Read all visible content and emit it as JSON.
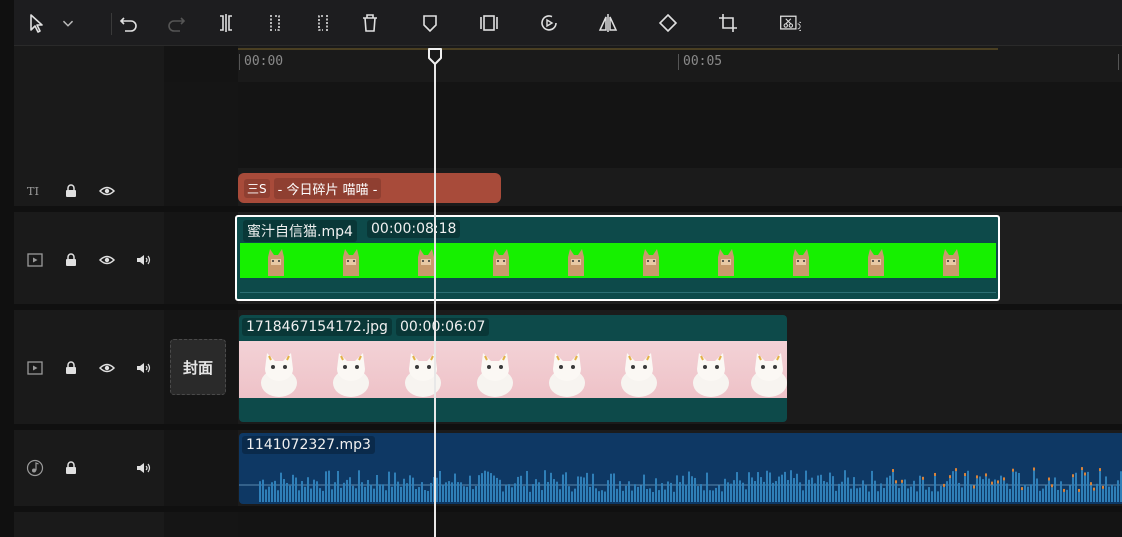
{
  "toolbar": {
    "icons": [
      "select-arrow-icon",
      "dropdown-chevron-icon",
      "undo-icon",
      "redo-icon",
      "split-icon",
      "trim-left-icon",
      "trim-right-icon",
      "delete-icon",
      "marker-icon",
      "freeze-frame-icon",
      "reverse-play-icon",
      "mirror-icon",
      "rotate-icon",
      "crop-icon",
      "cutout-icon"
    ]
  },
  "ruler": {
    "label_0": "00:00",
    "label_5": "00:05"
  },
  "tracks": {
    "text": {
      "clip_glyph": "三S",
      "clip_name": "- 今日碎片 喵喵 -"
    },
    "main_video": {
      "file_name": "蜜汁自信猫.mp4",
      "duration": "00:00:08:18"
    },
    "overlay_image": {
      "file_name": "1718467154172.jpg",
      "duration": "00:00:06:07"
    },
    "audio": {
      "file_name": "1141072327.mp3"
    }
  },
  "cover_label": "封面",
  "colors": {
    "text_clip": "#a84b3a",
    "video_clip": "#0d4a4a",
    "audio_clip": "#0e3864",
    "green_screen": "#16f000",
    "playhead": "#e8e8e8"
  }
}
